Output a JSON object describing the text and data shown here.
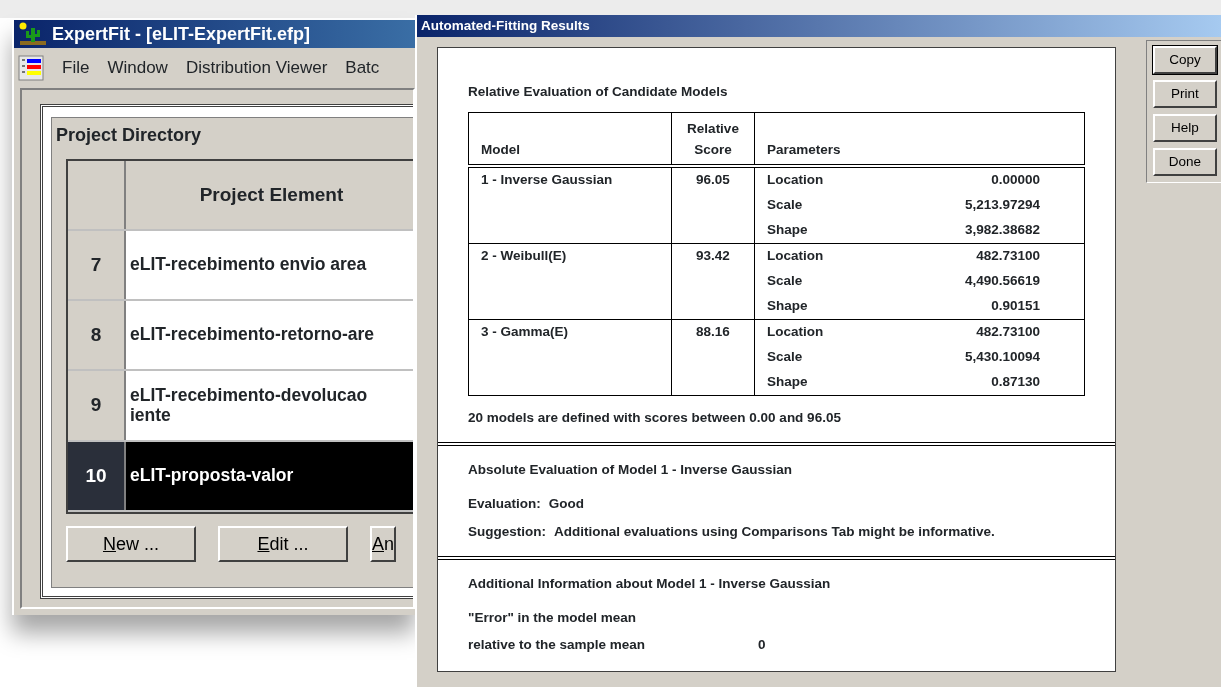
{
  "main_window": {
    "title": "ExpertFit - [eLIT-ExpertFit.efp]",
    "menu": [
      "File",
      "Window",
      "Distribution Viewer",
      "Batc"
    ],
    "project_directory": {
      "title": "Project Directory",
      "column": "Project Element",
      "rows": [
        {
          "number": "7",
          "lines": [
            "eLIT-recebimento envio area"
          ],
          "selected": false
        },
        {
          "number": "8",
          "lines": [
            "eLIT-recebimento-retorno-are"
          ],
          "selected": false
        },
        {
          "number": "9",
          "lines": [
            "eLIT-recebimento-devolucao",
            "iente"
          ],
          "selected": false
        },
        {
          "number": "10",
          "lines": [
            "eLIT-proposta-valor"
          ],
          "selected": true
        }
      ],
      "buttons": [
        {
          "mnemonic": "N",
          "rest": "ew ..."
        },
        {
          "mnemonic": "E",
          "rest": "dit ..."
        },
        {
          "mnemonic": "A",
          "rest": "n"
        }
      ]
    }
  },
  "dialog": {
    "title": "Automated-Fitting Results",
    "relative": {
      "heading": "Relative Evaluation of Candidate Models",
      "columns": {
        "model": "Model",
        "score": [
          "Relative",
          "Score"
        ],
        "parameters": "Parameters"
      },
      "models": [
        {
          "name": "1 - Inverse Gaussian",
          "score": "96.05",
          "parameters": [
            {
              "name": "Location",
              "value": "0.00000"
            },
            {
              "name": "Scale",
              "value": "5,213.97294"
            },
            {
              "name": "Shape",
              "value": "3,982.38682"
            }
          ]
        },
        {
          "name": "2 - Weibull(E)",
          "score": "93.42",
          "parameters": [
            {
              "name": "Location",
              "value": "482.73100"
            },
            {
              "name": "Scale",
              "value": "4,490.56619"
            },
            {
              "name": "Shape",
              "value": "0.90151"
            }
          ]
        },
        {
          "name": "3 - Gamma(E)",
          "score": "88.16",
          "parameters": [
            {
              "name": "Location",
              "value": "482.73100"
            },
            {
              "name": "Scale",
              "value": "5,430.10094"
            },
            {
              "name": "Shape",
              "value": "0.87130"
            }
          ]
        }
      ],
      "summary": "20 models are defined with scores between 0.00 and 96.05"
    },
    "absolute": {
      "heading": "Absolute Evaluation of Model 1 - Inverse Gaussian",
      "lines": [
        {
          "label": "Evaluation:",
          "value": "Good"
        },
        {
          "label": "Suggestion:",
          "value": "Additional evaluations using Comparisons Tab might be informative."
        }
      ]
    },
    "additional": {
      "heading": "Additional Information about Model 1 - Inverse Gaussian",
      "error_lines": [
        "\"Error\" in the model mean",
        "relative to the sample mean"
      ],
      "error_value": "0"
    },
    "buttons": [
      {
        "label": "Copy",
        "default": true
      },
      {
        "label": "Print",
        "default": false
      },
      {
        "label": "Help",
        "default": false
      },
      {
        "label": "Done",
        "default": false
      }
    ]
  }
}
